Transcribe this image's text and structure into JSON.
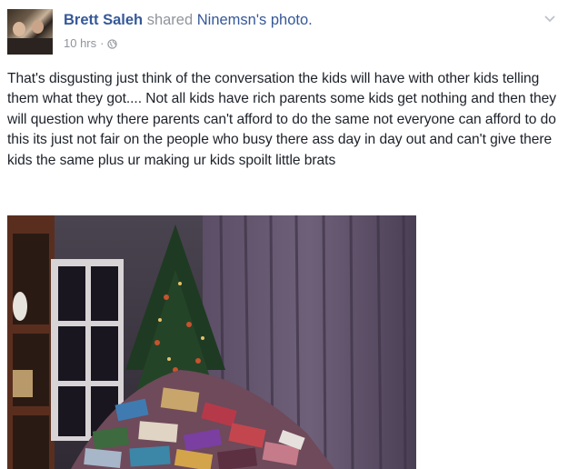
{
  "post": {
    "author": "Brett Saleh",
    "action": "shared",
    "shared_from": "Ninemsn's photo.",
    "timestamp": "10 hrs",
    "separator": "·",
    "privacy_icon": "globe-icon",
    "menu_icon": "chevron-down-icon",
    "text": "That's disgusting just think of the conversation the kids will have with other kids telling them what they got.... Not all kids have rich parents some kids get nothing and then they will question why there parents can't afford to do the same not everyone can afford to do this its just not fair on the people who busy there ass day in day out and can't give there kids the same plus ur making ur kids spoilt little brats"
  },
  "colors": {
    "link": "#365899",
    "meta": "#90949c",
    "text": "#1d2129"
  }
}
